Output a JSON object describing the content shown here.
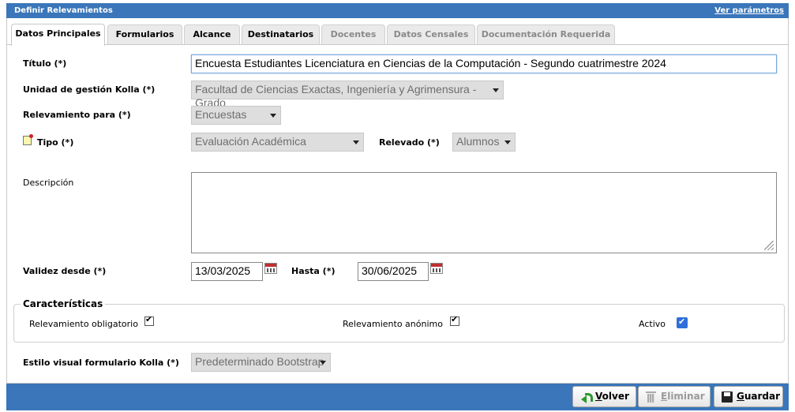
{
  "header": {
    "title": "Definir Relevamientos",
    "link": "Ver parámetros"
  },
  "tabs": [
    {
      "label": "Datos Principales",
      "state": "active"
    },
    {
      "label": "Formularios",
      "state": "enabled"
    },
    {
      "label": "Alcance",
      "state": "enabled"
    },
    {
      "label": "Destinatarios",
      "state": "enabled"
    },
    {
      "label": "Docentes",
      "state": "disabled"
    },
    {
      "label": "Datos Censales",
      "state": "disabled"
    },
    {
      "label": "Documentación Requerida",
      "state": "disabled"
    }
  ],
  "form": {
    "titulo": {
      "label": "Título (*)",
      "value": "Encuesta Estudiantes Licenciatura en Ciencias de la Computación - Segundo cuatrimestre 2024"
    },
    "unidad": {
      "label": "Unidad de gestión Kolla (*)",
      "value": "Facultad de Ciencias Exactas, Ingeniería y Agrimensura - Grado"
    },
    "relevamiento_para": {
      "label": "Relevamiento para (*)",
      "value": "Encuestas"
    },
    "tipo": {
      "label": "Tipo (*)",
      "value": "Evaluación Académica"
    },
    "relevado": {
      "label": "Relevado (*)",
      "value": "Alumnos"
    },
    "descripcion": {
      "label": "Descripción",
      "value": ""
    },
    "validez_desde": {
      "label": "Validez desde (*)",
      "value": "13/03/2025"
    },
    "hasta": {
      "label": "Hasta (*)",
      "value": "30/06/2025"
    },
    "estilo": {
      "label": "Estilo visual formulario Kolla (*)",
      "value": "Predeterminado Bootstrap"
    }
  },
  "caracteristicas": {
    "legend": "Características",
    "obligatorio": {
      "label": "Relevamiento obligatorio",
      "checked": true
    },
    "anonimo": {
      "label": "Relevamiento anónimo",
      "checked": true
    },
    "activo": {
      "label": "Activo",
      "checked": true
    }
  },
  "footer": {
    "volver_u": "V",
    "volver_rest": "olver",
    "eliminar_u": "E",
    "eliminar_rest": "liminar",
    "guardar_u": "G",
    "guardar_rest": "uardar"
  },
  "colors": {
    "header_bg": "#3a76b9",
    "checkbox_active": "#2f6fdc"
  }
}
